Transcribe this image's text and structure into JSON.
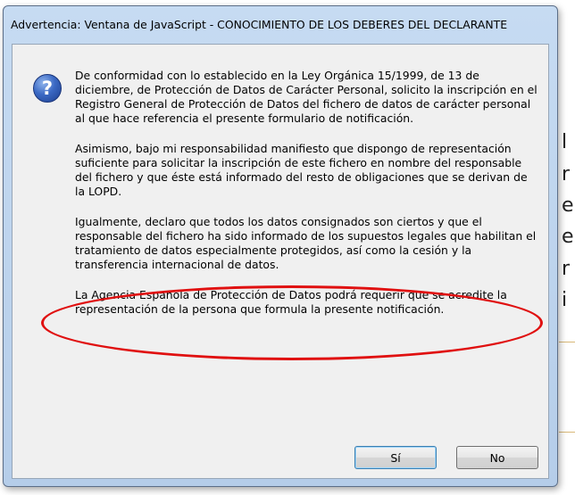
{
  "dialog": {
    "title": "Advertencia: Ventana de JavaScript - CONOCIMIENTO DE LOS DEBERES DEL DECLARANTE",
    "icon": "question-icon",
    "paragraphs": [
      "De conformidad con lo establecido en la Ley Orgánica 15/1999, de 13 de diciembre, de Protección de Datos de Carácter Personal, solicito la inscripción en el Registro General de Protección de Datos del fichero de datos de carácter personal al que hace referencia el presente formulario de notificación.",
      "Asimismo, bajo mi responsabilidad manifiesto que dispongo de representación suficiente para solicitar la inscripción de este fichero en nombre del responsable del fichero y que éste está informado del resto de obligaciones que se derivan de la LOPD.",
      "Igualmente, declaro que todos los datos consignados son ciertos y que el responsable del fichero ha sido informado de los supuestos legales que habilitan el tratamiento de datos especialmente protegidos, así como la cesión y la transferencia internacional de datos.",
      "La Agencia Española de Protección de Datos podrá requerir que se acredite la representación de la persona que formula la presente notificación."
    ],
    "yes_label": "Sí",
    "no_label": "No"
  },
  "background": {
    "fragments": [
      "l",
      "r",
      "e",
      "e",
      "r",
      "i"
    ]
  },
  "colors": {
    "highlight_oval": "#e01010",
    "titlebar": "#c6dbf2",
    "client": "#f0f0f0"
  }
}
